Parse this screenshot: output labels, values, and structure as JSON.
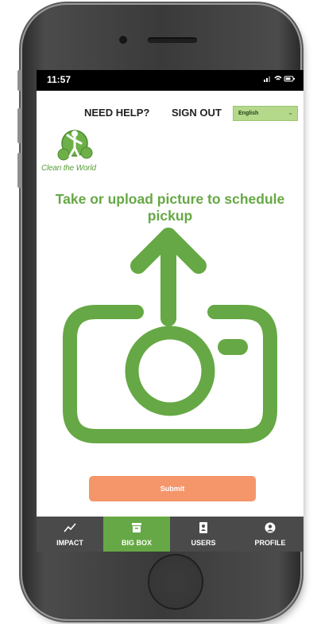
{
  "status_bar": {
    "time": "11:57",
    "indicators": "signal wifi battery"
  },
  "topnav": {
    "help": "NEED HELP?",
    "signout": "SIGN OUT",
    "language": "English"
  },
  "logo": {
    "text": "Clean the World"
  },
  "main": {
    "heading": "Take or upload picture to schedule pickup",
    "submit_label": "Submit"
  },
  "tabs": [
    {
      "label": "IMPACT",
      "icon": "trend-chart-icon",
      "active": false
    },
    {
      "label": "BIG BOX",
      "icon": "box-icon",
      "active": true
    },
    {
      "label": "USERS",
      "icon": "contact-card-icon",
      "active": false
    },
    {
      "label": "PROFILE",
      "icon": "user-circle-icon",
      "active": false
    }
  ],
  "colors": {
    "brand_green": "#66a845",
    "submit_orange": "#f4956a",
    "tabbar_bg": "#4a4a4a",
    "lang_bg": "#b5d98b"
  }
}
